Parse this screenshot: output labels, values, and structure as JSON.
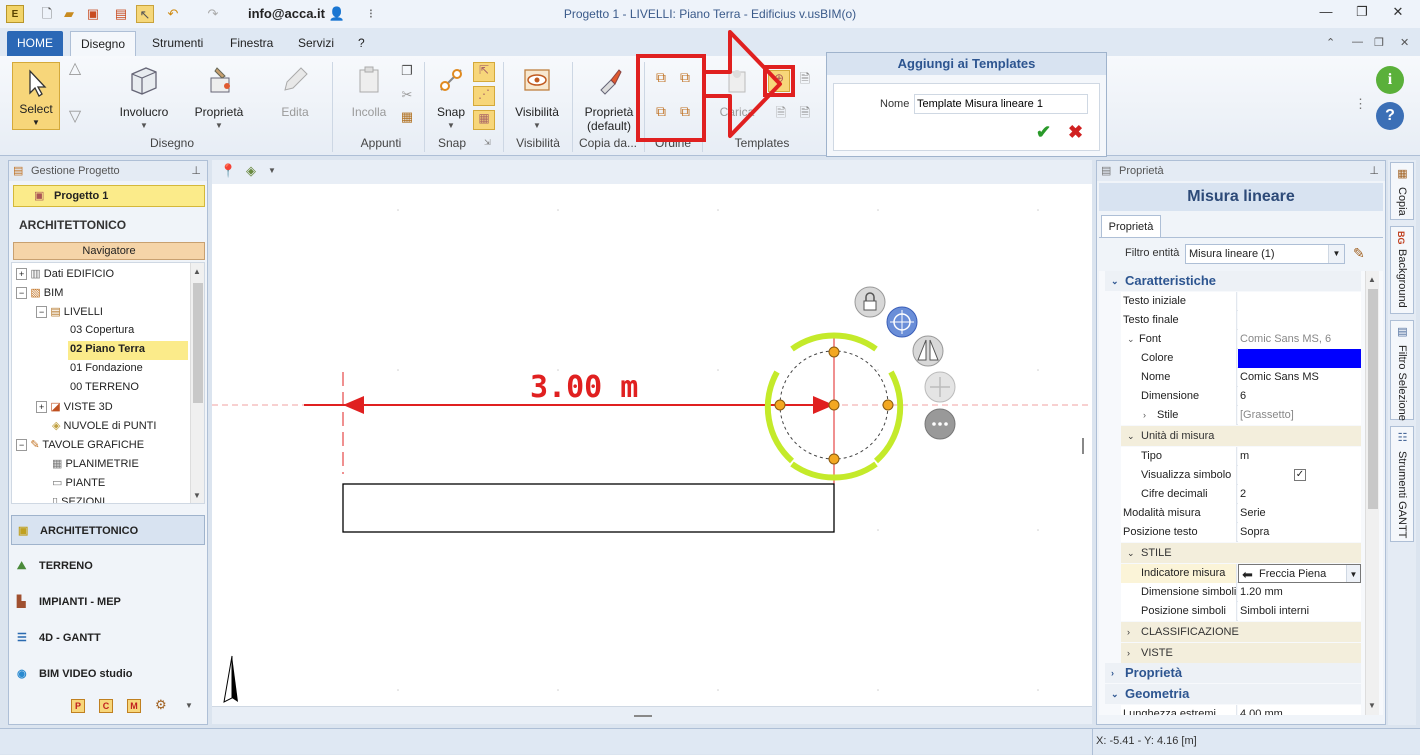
{
  "titlebar": {
    "user": "info@acca.it",
    "title": "Progetto 1 -  LIVELLI: Piano Terra - Edificius v.usBIM(o)"
  },
  "menu": {
    "tabs": [
      "HOME",
      "Disegno",
      "Strumenti",
      "Finestra",
      "Servizi",
      "?"
    ]
  },
  "ribbon": {
    "select": "Select",
    "involucro": "Involucro",
    "proprieta": "Proprietà",
    "edita": "Edita",
    "incolla": "Incolla",
    "snap": "Snap",
    "visibilita": "Visibilità",
    "proprieta_default_1": "Proprietà",
    "proprieta_default_2": "(default)",
    "carica": "Carica",
    "groups": {
      "disegno": "Disegno",
      "appunti": "Appunti",
      "snap": "Snap",
      "visibilita": "Visibilità",
      "copia": "Copia da...",
      "ordine": "Ordine",
      "templates": "Templates"
    }
  },
  "popup": {
    "title": "Aggiungi ai Templates",
    "name_label": "Nome",
    "name_value": "Template Misura lineare 1"
  },
  "left": {
    "header": "Gestione Progetto",
    "project": "Progetto 1",
    "section": "ARCHITETTONICO",
    "navigator": "Navigatore",
    "tree": [
      "Dati EDIFICIO",
      "BIM",
      "LIVELLI",
      "03 Copertura",
      "02 Piano Terra",
      "01 Fondazione",
      "00 TERRENO",
      "VISTE 3D",
      "NUVOLE di PUNTI",
      "TAVOLE GRAFICHE",
      "PLANIMETRIE",
      "PIANTE",
      "SEZIONI"
    ],
    "modules": [
      "ARCHITETTONICO",
      "TERRENO",
      "IMPIANTI - MEP",
      "4D - GANTT",
      "BIM VIDEO studio"
    ],
    "bottom_icons": [
      "P",
      "C",
      "M"
    ]
  },
  "canvas": {
    "measure_label": "3.00 m"
  },
  "right": {
    "header": "Proprietà",
    "title": "Misura lineare",
    "tab": "Proprietà",
    "filter_label": "Filtro entità",
    "filter_value": "Misura lineare (1)",
    "sec_caratteristiche": "Caratteristiche",
    "testo_iniziale": "Testo iniziale",
    "testo_finale": "Testo finale",
    "font_k": "Font",
    "font_v": "Comic Sans MS, 6",
    "colore": "Colore",
    "nome_k": "Nome",
    "nome_v": "Comic Sans MS",
    "dim_k": "Dimensione",
    "dim_v": "6",
    "stile_k": "Stile",
    "stile_v": "[Grassetto]",
    "unita": "Unità di misura",
    "tipo_k": "Tipo",
    "tipo_v": "m",
    "vis_k": "Visualizza simbolo",
    "cifre_k": "Cifre decimali",
    "cifre_v": "2",
    "mod_k": "Modalità misura",
    "mod_v": "Serie",
    "pos_k": "Posizione testo",
    "pos_v": "Sopra",
    "stile_sec": "STILE",
    "ind_k": "Indicatore misura",
    "ind_v": "Freccia Piena",
    "dsim_k": "Dimensione simboli",
    "dsim_v": "1.20 mm",
    "psim_k": "Posizione simboli",
    "psim_v": "Simboli interni",
    "class": "CLASSIFICAZIONE",
    "viste": "VISTE",
    "sec_proprieta": "Proprietà",
    "sec_geometria": "Geometria",
    "lung_k": "Lunghezza estremi",
    "lung_v": "4.00 mm"
  },
  "vtabs": [
    "Copia",
    "Background",
    "Filtro Selezione",
    "Strumenti GANTT"
  ],
  "status": {
    "coords": "X: -5.41 - Y: 4.16 [m]"
  },
  "colors": {
    "accent": "#2b68b6",
    "highlight": "#e02020",
    "font_color": "#0000ff",
    "yellow_sel": "#fbeb8a"
  }
}
